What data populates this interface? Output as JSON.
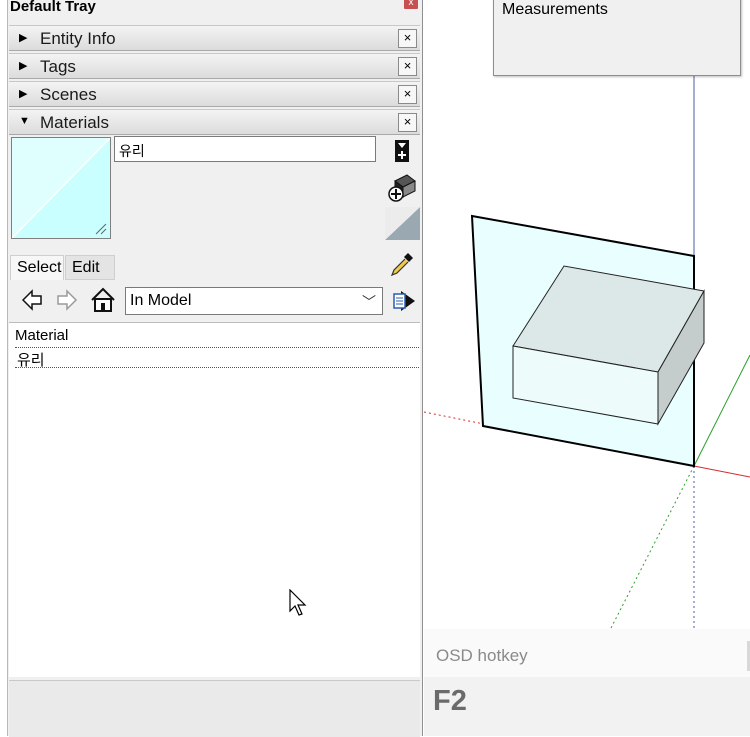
{
  "tray": {
    "title": "Default Tray",
    "close": "x",
    "panels": [
      {
        "label": "Entity Info",
        "expanded": false
      },
      {
        "label": "Tags",
        "expanded": false
      },
      {
        "label": "Scenes",
        "expanded": false
      },
      {
        "label": "Materials",
        "expanded": true
      }
    ],
    "panel_close": "×"
  },
  "materials": {
    "name": "유리",
    "swatch_color": "#dfffff",
    "tabs": [
      "Select",
      "Edit"
    ],
    "collection": "In Model",
    "list_header": "Material",
    "items": [
      "유리"
    ]
  },
  "measurements": {
    "label": "Measurements"
  },
  "osd": {
    "title": "OSD hotkey",
    "key": "F2"
  }
}
